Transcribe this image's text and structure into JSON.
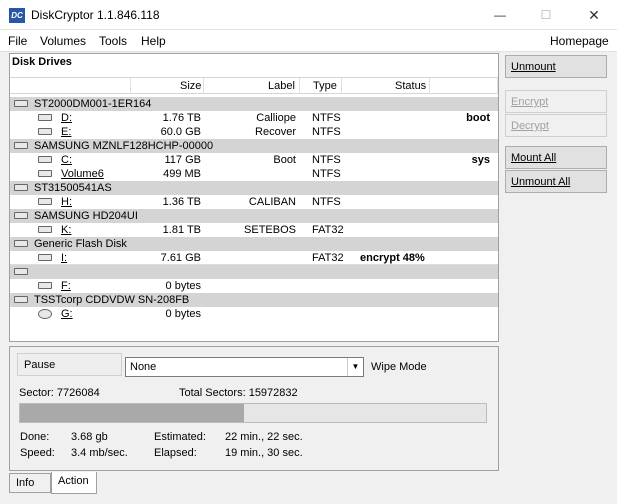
{
  "window": {
    "title": "DiskCryptor 1.1.846.118",
    "icon_text": "DC",
    "minimize_glyph": "—",
    "maximize_glyph": "☐",
    "close_glyph": "✕"
  },
  "menu": {
    "file": "File",
    "volumes": "Volumes",
    "tools": "Tools",
    "help": "Help",
    "homepage": "Homepage"
  },
  "disk_panel": {
    "title": "Disk Drives",
    "columns": {
      "size": "Size",
      "label": "Label",
      "type": "Type",
      "status": "Status"
    }
  },
  "drives": [
    {
      "kind": "disk",
      "name": "ST2000DM001-1ER164"
    },
    {
      "kind": "vol",
      "name": "D:",
      "size": "1.76 TB",
      "label": "Calliope",
      "type": "NTFS",
      "flag": "boot",
      "icon": "disk-icon"
    },
    {
      "kind": "vol",
      "name": "E:",
      "size": "60.0 GB",
      "label": "Recover",
      "type": "NTFS",
      "flag": "",
      "icon": "disk-icon"
    },
    {
      "kind": "disk",
      "name": "SAMSUNG MZNLF128HCHP-00000"
    },
    {
      "kind": "vol",
      "name": "C:",
      "size": "117 GB",
      "label": "Boot",
      "type": "NTFS",
      "flag": "sys",
      "icon": "disk-icon"
    },
    {
      "kind": "vol",
      "name": "Volume6",
      "size": "499 MB",
      "label": "",
      "type": "NTFS",
      "flag": "",
      "icon": "disk-icon"
    },
    {
      "kind": "disk",
      "name": "ST31500541AS"
    },
    {
      "kind": "vol",
      "name": "H:",
      "size": "1.36 TB",
      "label": "CALIBAN",
      "type": "NTFS",
      "flag": "",
      "icon": "disk-icon"
    },
    {
      "kind": "disk",
      "name": "SAMSUNG HD204UI"
    },
    {
      "kind": "vol",
      "name": "K:",
      "size": "1.81 TB",
      "label": "SETEBOS",
      "type": "FAT32",
      "flag": "",
      "icon": "disk-icon"
    },
    {
      "kind": "disk",
      "name": "Generic Flash Disk"
    },
    {
      "kind": "vol",
      "name": "I:",
      "size": "7.61 GB",
      "label": "",
      "type": "FAT32",
      "status": "encrypt 48%",
      "flag": "",
      "icon": "disk-icon",
      "selected": true
    },
    {
      "kind": "disk",
      "name": ""
    },
    {
      "kind": "vol",
      "name": "F:",
      "size": "0 bytes",
      "label": "",
      "type": "",
      "flag": "",
      "icon": "disk-icon"
    },
    {
      "kind": "disk",
      "name": "TSSTcorp CDDVDW SN-208FB"
    },
    {
      "kind": "vol",
      "name": "G:",
      "size": "0 bytes",
      "label": "",
      "type": "",
      "flag": "",
      "icon": "cd-icon"
    }
  ],
  "buttons": {
    "unmount": "Unmount",
    "encrypt": "Encrypt",
    "decrypt": "Decrypt",
    "mount_all": "Mount All",
    "unmount_all": "Unmount All"
  },
  "action": {
    "pause": "Pause",
    "wipe_selected": "None",
    "wipe_label": "Wipe Mode",
    "sector": "Sector: 7726084",
    "total_sectors": "Total Sectors: 15972832",
    "progress_percent": 48,
    "done_label": "Done:",
    "done_value": "3.68 gb",
    "speed_label": "Speed:",
    "speed_value": "3.4 mb/sec.",
    "estimated_label": "Estimated:",
    "estimated_value": "22 min., 22 sec.",
    "elapsed_label": "Elapsed:",
    "elapsed_value": "19 min., 30 sec."
  },
  "tabs": {
    "info": "Info",
    "action": "Action"
  }
}
